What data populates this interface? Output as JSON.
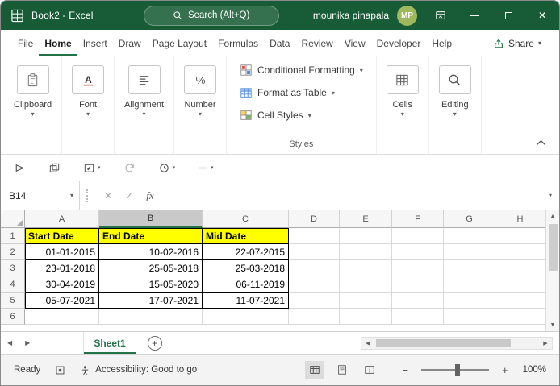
{
  "titlebar": {
    "app_title": "Book2 - Excel",
    "search_placeholder": "Search (Alt+Q)",
    "user_name": "mounika pinapala",
    "user_initials": "MP"
  },
  "tabs": {
    "items": [
      "File",
      "Home",
      "Insert",
      "Draw",
      "Page Layout",
      "Formulas",
      "Data",
      "Review",
      "View",
      "Developer",
      "Help"
    ],
    "active": "Home",
    "share_label": "Share"
  },
  "ribbon": {
    "clipboard_label": "Clipboard",
    "font_label": "Font",
    "alignment_label": "Alignment",
    "number_label": "Number",
    "styles_items": [
      "Conditional Formatting",
      "Format as Table",
      "Cell Styles"
    ],
    "styles_label": "Styles",
    "cells_label": "Cells",
    "editing_label": "Editing"
  },
  "formula_bar": {
    "name_box_value": "B14",
    "fx_label": "fx",
    "formula_value": ""
  },
  "grid": {
    "column_headers": [
      "A",
      "B",
      "C",
      "D",
      "E",
      "F",
      "G",
      "H"
    ],
    "selected_column": "B",
    "row_headers": [
      "1",
      "2",
      "3",
      "4",
      "5",
      "6"
    ],
    "table": {
      "headers": [
        "Start Date",
        "End Date",
        "Mid Date"
      ],
      "rows": [
        [
          "01-01-2015",
          "10-02-2016",
          "22-07-2015"
        ],
        [
          "23-01-2018",
          "25-05-2018",
          "25-03-2018"
        ],
        [
          "30-04-2019",
          "15-05-2020",
          "06-11-2019"
        ],
        [
          "05-07-2021",
          "17-07-2021",
          "11-07-2021"
        ]
      ],
      "header_fill_color": "#FFFF00"
    }
  },
  "sheet_bar": {
    "sheets": [
      {
        "name": "Sheet1",
        "active": true
      }
    ]
  },
  "status_bar": {
    "mode": "Ready",
    "accessibility": "Accessibility: Good to go",
    "zoom": "100%"
  },
  "colors": {
    "title_bar_green": "#185C37",
    "accent_green": "#217346",
    "header_fill_yellow": "#FFFF00",
    "selected_header_gray": "#C9C9C9"
  },
  "icons": {
    "dropdown": "▾",
    "close": "✕",
    "minus": "−",
    "plus": "+",
    "left_arrow": "◀",
    "right_arrow": "▶",
    "up_arrow": "▲",
    "down_arrow": "▼"
  }
}
